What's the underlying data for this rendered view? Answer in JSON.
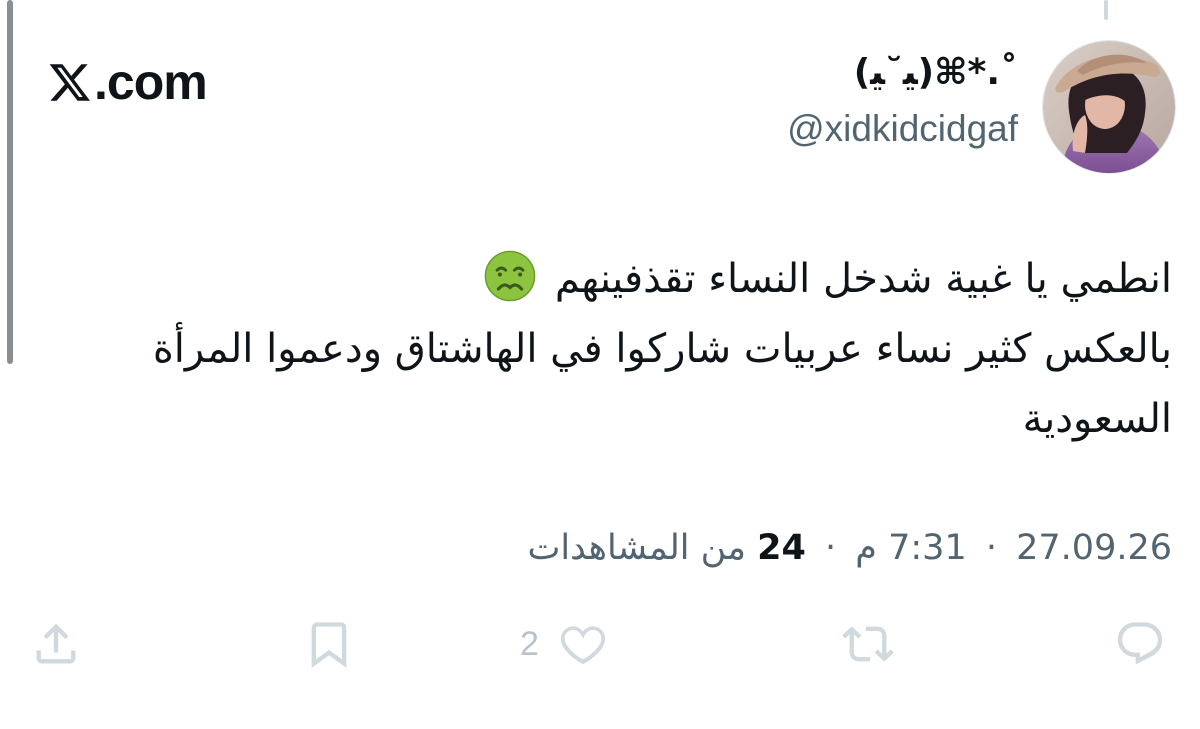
{
  "brand": {
    "text": ".com",
    "logo_icon": "x-logo-icon"
  },
  "author": {
    "display_name": "(ﻴ˘ﻴ)⌘*.˚",
    "handle": "@xidkidcidgaf"
  },
  "tweet": {
    "line1": "انطمي يا غبية شدخل النساء تقذفينهم",
    "line2": "بالعكس كثير نساء عربيات شاركوا في الهاشتاق ودعموا المرأة",
    "line3": "السعودية",
    "emoji": "nauseated-face-icon"
  },
  "meta": {
    "date": "27.09.26",
    "time": "7:31",
    "ampm": "م",
    "views_count": "24",
    "views_label": "من المشاهدات",
    "dot": "·"
  },
  "actions": {
    "reply_icon": "reply-icon",
    "retweet_icon": "retweet-icon",
    "like_icon": "heart-icon",
    "like_count": "2",
    "bookmark_icon": "bookmark-icon",
    "share_icon": "share-icon"
  },
  "colors": {
    "text_primary": "#0f1419",
    "text_secondary": "#536471",
    "icon": "#cfd9de",
    "emoji_green": "#8dc43f"
  }
}
